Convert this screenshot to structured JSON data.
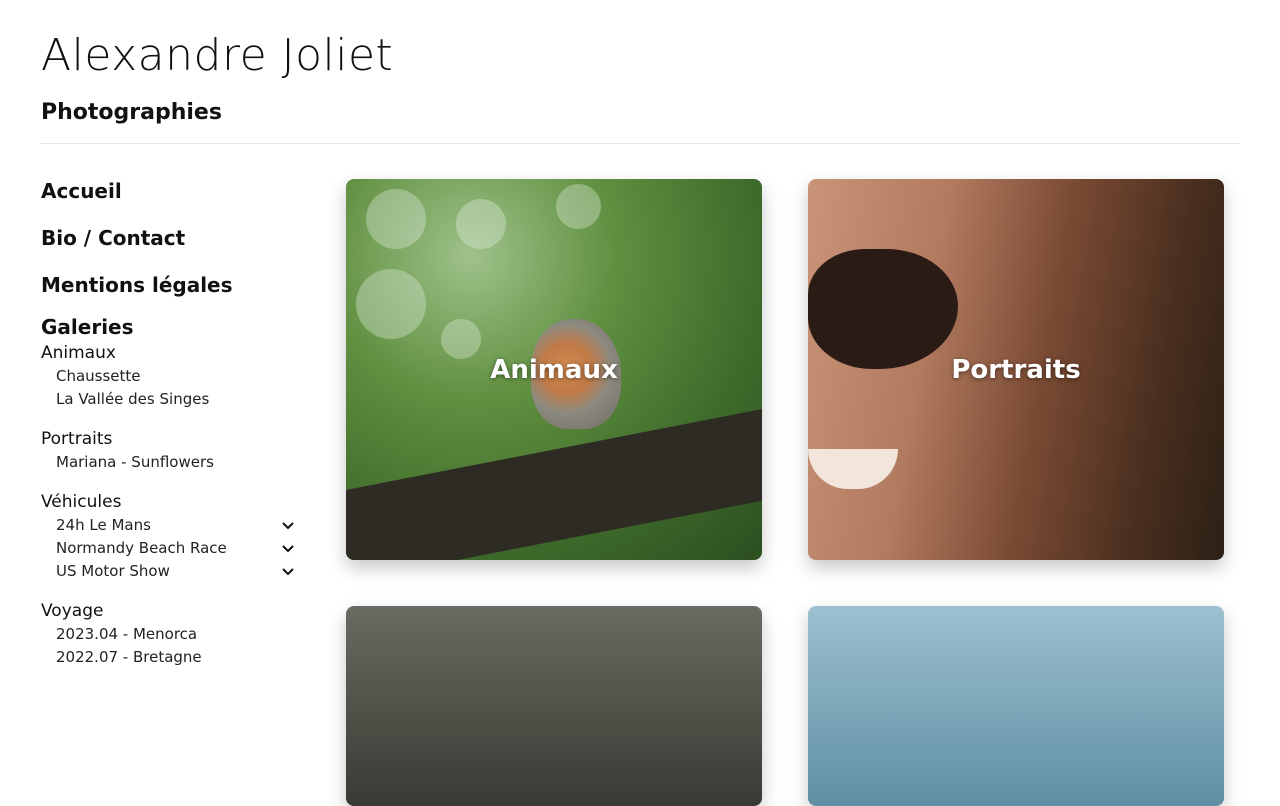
{
  "header": {
    "title": "Alexandre Joliet",
    "subtitle": "Photographies"
  },
  "nav": {
    "items": [
      {
        "label": "Accueil"
      },
      {
        "label": "Bio / Contact"
      },
      {
        "label": "Mentions légales"
      }
    ],
    "galleries_title": "Galeries",
    "categories": [
      {
        "label": "Animaux",
        "items": [
          {
            "label": "Chaussette"
          },
          {
            "label": "La Vallée des Singes"
          }
        ]
      },
      {
        "label": "Portraits",
        "items": [
          {
            "label": "Mariana - Sunflowers"
          }
        ]
      },
      {
        "label": "Véhicules",
        "items": [
          {
            "label": "24h Le Mans",
            "icon": "chevron-down-icon"
          },
          {
            "label": "Normandy Beach Race",
            "icon": "chevron-down-icon"
          },
          {
            "label": "US Motor Show",
            "icon": "chevron-down-icon"
          }
        ]
      },
      {
        "label": "Voyage",
        "items": [
          {
            "label": "2023.04 - Menorca"
          },
          {
            "label": "2022.07 - Bretagne"
          }
        ]
      }
    ]
  },
  "gallery": {
    "cards": [
      {
        "label": "Animaux"
      },
      {
        "label": "Portraits"
      },
      {
        "label": ""
      },
      {
        "label": ""
      }
    ]
  },
  "colors": {
    "text": "#111111",
    "divider": "#e6e6e6",
    "card_label": "#ffffff"
  }
}
